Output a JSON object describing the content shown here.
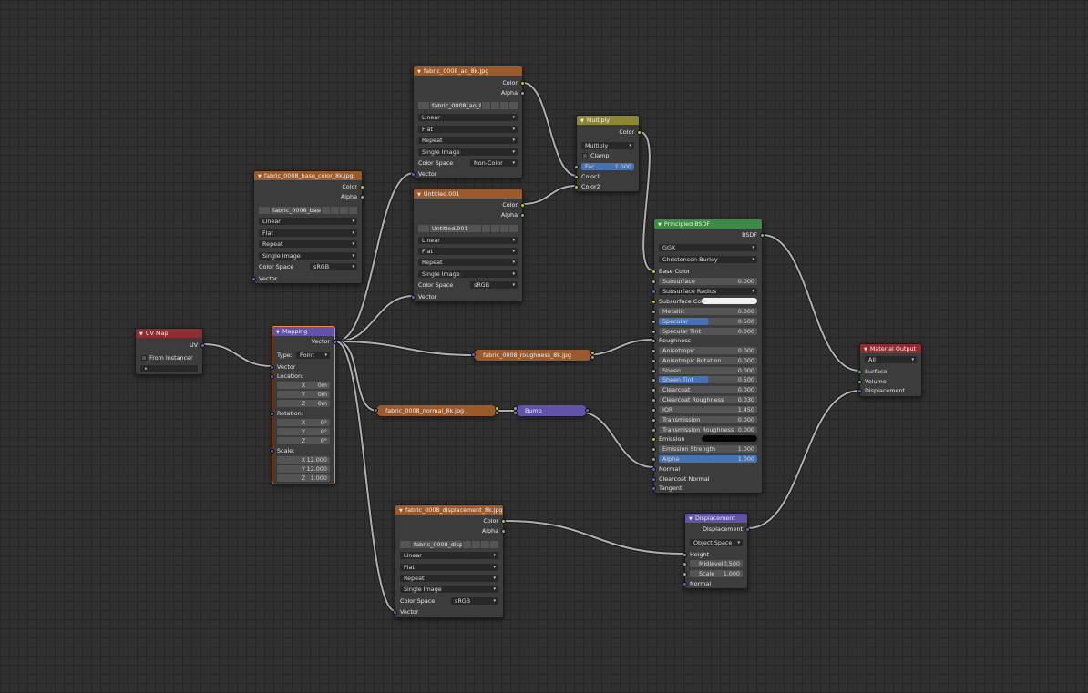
{
  "uv_map": {
    "title": "UV Map",
    "out_uv": "UV",
    "from_instancer": "From Instancer",
    "field_value": "•"
  },
  "mapping": {
    "title": "Mapping",
    "out_vector": "Vector",
    "type_label": "Type:",
    "type_value": "Point",
    "in_vector": "Vector",
    "location_label": "Location:",
    "rotation_label": "Rotation:",
    "scale_label": "Scale:",
    "loc": [
      {
        "axis": "X",
        "value": "0m"
      },
      {
        "axis": "Y",
        "value": "0m"
      },
      {
        "axis": "Z",
        "value": "0m"
      }
    ],
    "rot": [
      {
        "axis": "X",
        "value": "0°"
      },
      {
        "axis": "Y",
        "value": "0°"
      },
      {
        "axis": "Z",
        "value": "0°"
      }
    ],
    "scale": [
      {
        "axis": "X",
        "value": "12.000"
      },
      {
        "axis": "Y",
        "value": "12.000"
      },
      {
        "axis": "Z",
        "value": "1.000"
      }
    ]
  },
  "base_tex": {
    "title": "fabric_0008_base_color_8k.jpg",
    "out_color": "Color",
    "out_alpha": "Alpha",
    "image_name": "fabric_0008_base...",
    "interp": "Linear",
    "proj": "Flat",
    "ext": "Repeat",
    "source": "Single Image",
    "cs_label": "Color Space",
    "cs_value": "sRGB",
    "in_vector": "Vector"
  },
  "ao_tex": {
    "title": "fabric_0008_ao_8k.jpg",
    "out_color": "Color",
    "out_alpha": "Alpha",
    "image_name": "fabric_0008_ao_8...",
    "interp": "Linear",
    "proj": "Flat",
    "ext": "Repeat",
    "source": "Single Image",
    "cs_label": "Color Space",
    "cs_value": "Non-Color",
    "in_vector": "Vector"
  },
  "untitled_tex": {
    "title": "Untitled.001",
    "out_color": "Color",
    "out_alpha": "Alpha",
    "image_name": "Untitled.001",
    "interp": "Linear",
    "proj": "Flat",
    "ext": "Repeat",
    "source": "Single Image",
    "cs_label": "Color Space",
    "cs_value": "sRGB",
    "in_vector": "Vector"
  },
  "disp_tex": {
    "title": "fabric_0008_displacement_8k.jpg",
    "out_color": "Color",
    "out_alpha": "Alpha",
    "image_name": "fabric_0008_displa...",
    "interp": "Linear",
    "proj": "Flat",
    "ext": "Repeat",
    "source": "Single Image",
    "cs_label": "Color Space",
    "cs_value": "sRGB",
    "in_vector": "Vector"
  },
  "multiply": {
    "title": "Multiply",
    "out_color": "Color",
    "blend": "Multiply",
    "clamp": "Clamp",
    "fac_label": "Fac",
    "fac_value": "1.000",
    "fac_fill": 1.0,
    "in_color1": "Color1",
    "in_color2": "Color2"
  },
  "roughness_tex": {
    "title": "fabric_0008_roughness_8k.jpg"
  },
  "normal_tex": {
    "title": "fabric_0008_normal_8k.jpg"
  },
  "bump": {
    "title": "Bump"
  },
  "bsdf": {
    "title": "Principled BSDF",
    "out_bsdf": "BSDF",
    "distribution": "GGX",
    "sss_method": "Christensen-Burley",
    "base_color": "Base Color",
    "subsurface": {
      "label": "Subsurface",
      "value": "0.000"
    },
    "subsurface_radius": "Subsurface Radius",
    "subsurface_color": "Subsurface Colo",
    "metallic": {
      "label": "Metallic",
      "value": "0.000"
    },
    "specular": {
      "label": "Specular",
      "value": "0.500",
      "fill": 0.5
    },
    "specular_tint": {
      "label": "Specular Tint",
      "value": "0.000"
    },
    "roughness": "Roughness",
    "anisotropic": {
      "label": "Anisotropic",
      "value": "0.000"
    },
    "aniso_rot": {
      "label": "Anisotropic Rotation",
      "value": "0.000"
    },
    "sheen": {
      "label": "Sheen",
      "value": "0.000"
    },
    "sheen_tint": {
      "label": "Sheen Tint",
      "value": "0.500",
      "fill": 0.5
    },
    "clearcoat": {
      "label": "Clearcoat",
      "value": "0.000"
    },
    "clearcoat_rough": {
      "label": "Clearcoat Roughness",
      "value": "0.030"
    },
    "ior": {
      "label": "IOR",
      "value": "1.450"
    },
    "transmission": {
      "label": "Transmission",
      "value": "0.000"
    },
    "trans_rough": {
      "label": "Transmission Roughness",
      "value": "0.000"
    },
    "emission": "Emission",
    "emission_strength": {
      "label": "Emission Strength",
      "value": "1.000"
    },
    "alpha": {
      "label": "Alpha",
      "value": "1.000",
      "fill": 1.0
    },
    "normal": "Normal",
    "clearcoat_normal": "Clearcoat Normal",
    "tangent": "Tangent"
  },
  "material_output": {
    "title": "Material Output",
    "target": "All",
    "surface": "Surface",
    "volume": "Volume",
    "displacement": "Displacement"
  },
  "displacement": {
    "title": "Displacement",
    "out_disp": "Displacement",
    "space": "Object Space",
    "height": "Height",
    "midlevel": {
      "label": "Midlevel",
      "value": "0.500"
    },
    "scale": {
      "label": "Scale",
      "value": "1.000"
    },
    "normal": "Normal"
  },
  "colors": {
    "wire": "#b0b0b0",
    "color_socket": "#c7c729",
    "vector_socket": "#6363c7",
    "shader_socket": "#63c763",
    "float_socket": "#a1a1a1",
    "select_outline": "#f0884a"
  }
}
